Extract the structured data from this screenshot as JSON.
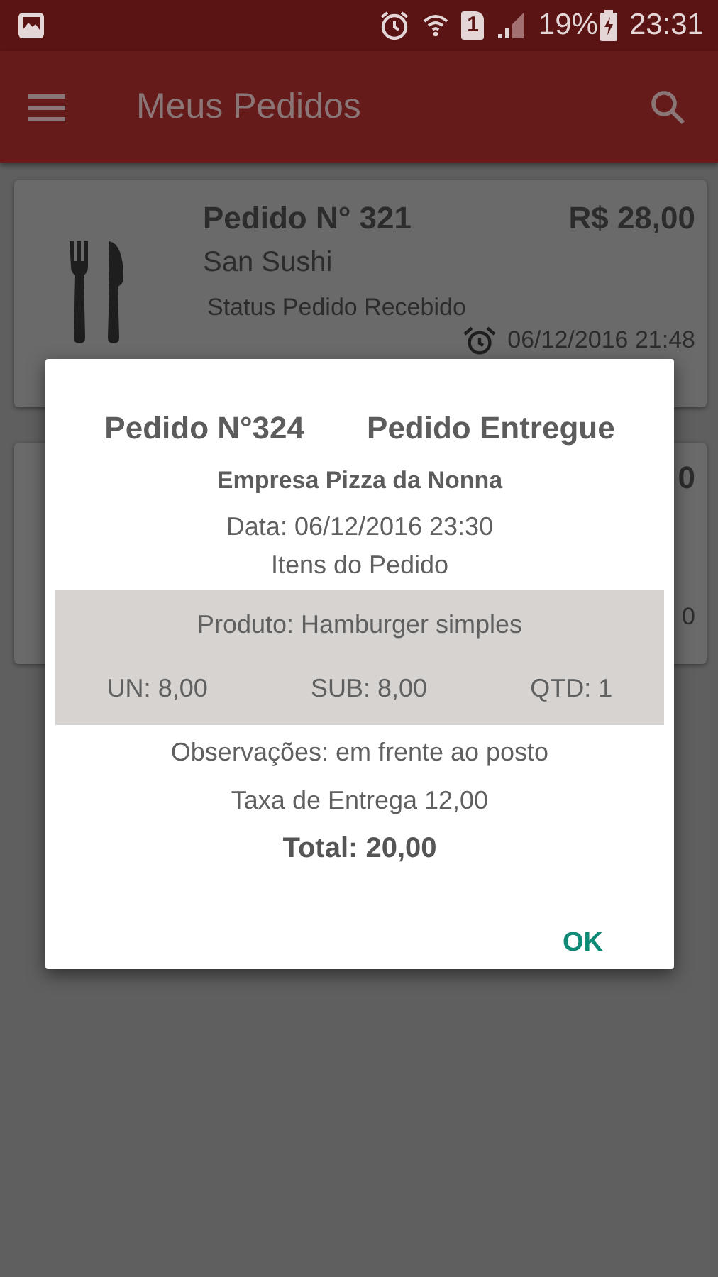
{
  "status_bar": {
    "sim_slot": "1",
    "battery": "19%",
    "time": "23:31"
  },
  "app_bar": {
    "title": "Meus Pedidos"
  },
  "orders": [
    {
      "number": "Pedido N° 321",
      "price": "R$ 28,00",
      "restaurant": "San Sushi",
      "status": "Status Pedido Recebido",
      "datetime": "06/12/2016 21:48"
    },
    {
      "price": "0",
      "datetime": "0"
    }
  ],
  "dialog": {
    "order_number": "Pedido N°324",
    "status": "Pedido Entregue",
    "company": "Empresa Pizza da Nonna",
    "date": "Data: 06/12/2016 23:30",
    "items_heading": "Itens do Pedido",
    "items": [
      {
        "product": "Produto: Hamburger simples",
        "unit": "UN: 8,00",
        "subtotal": "SUB: 8,00",
        "quantity": "QTD: 1"
      }
    ],
    "notes": "Observações: em frente ao posto",
    "delivery_fee": "Taxa de Entrega 12,00",
    "total": "Total: 20,00",
    "button": "OK"
  }
}
